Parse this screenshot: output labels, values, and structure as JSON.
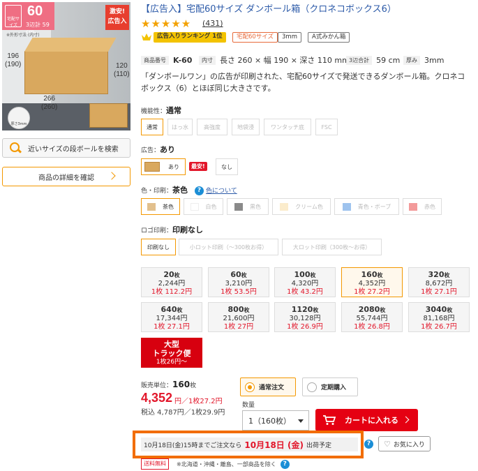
{
  "product": {
    "title": "【広告入】宅配60サイズ ダンボール箱（クロネコボックス6）",
    "stars": "★★★★★",
    "review_count": "(431)",
    "tags": {
      "ranking": "広告入りランキング 1位",
      "size": "宅配60サイズ",
      "thickness": "3mm",
      "type": "A式みかん箱"
    },
    "spec": {
      "code_label": "商品番号",
      "code": "K-60",
      "inner_label": "内寸",
      "inner": "長さ 260 × 幅 190 × 深さ 110 mm",
      "sum_label": "3辺合計",
      "sum": "59 cm",
      "thick_label": "厚み",
      "thick": "3mm"
    },
    "description": "「ダンボールワン」の広告が印刷された、宅配60サイズで発送できるダンボール箱。クロネコボックス（6）とほぼ同じ大きさです。"
  },
  "image": {
    "badge_number": "60",
    "badge_text": "3辺計 59 cm",
    "badge_icon": "宅配サイズ",
    "note": "※外形寸法 (内寸)",
    "sale_flag": "激安!",
    "sale_sub": "広告入",
    "dim_height": "196\n(190)",
    "dim_side": "120\n(110)",
    "dim_length": "266\n(260)",
    "thickness": "厚さ3mm"
  },
  "left": {
    "similar_label": "近いサイズの段ボールを検索",
    "details_label": "商品の詳細を確認"
  },
  "options": {
    "function": {
      "label": "機能性：",
      "value": "通常",
      "items": [
        "通常",
        "はっ水",
        "高強度",
        "地袋浸",
        "ワンタッチ底",
        "FSC"
      ]
    },
    "ad": {
      "label": "広告：",
      "value": "あり",
      "items": [
        "あり",
        "なし"
      ],
      "sale_badge": "最安!"
    },
    "color": {
      "label": "色・印刷：",
      "value": "茶色",
      "link": "色について",
      "items": [
        "茶色",
        "白色",
        "黒色",
        "クリーム色",
        "青色・ボーブ",
        "赤色"
      ],
      "swatches": [
        "#e2c08d",
        "#ffffff",
        "#8a8a8a",
        "#fbeccc",
        "#9ec3ee",
        "#f39a9a"
      ]
    },
    "logo": {
      "label": "ロゴ印刷：",
      "value": "印刷なし",
      "items": [
        "印刷なし",
        "小ロット印刷（～300枚お得）",
        "大ロット印刷（300枚～お得）"
      ]
    }
  },
  "quantities": [
    {
      "n": "20",
      "unit": "枚",
      "price": "2,244円",
      "per": "1枚 112.2円"
    },
    {
      "n": "60",
      "unit": "枚",
      "price": "3,210円",
      "per": "1枚 53.5円"
    },
    {
      "n": "100",
      "unit": "枚",
      "price": "4,320円",
      "per": "1枚 43.2円"
    },
    {
      "n": "160",
      "unit": "枚",
      "price": "4,352円",
      "per": "1枚 27.2円"
    },
    {
      "n": "320",
      "unit": "枚",
      "price": "8,672円",
      "per": "1枚 27.1円"
    },
    {
      "n": "640",
      "unit": "枚",
      "price": "17,344円",
      "per": "1枚 27.1円"
    },
    {
      "n": "800",
      "unit": "枚",
      "price": "21,600円",
      "per": "1枚 27円"
    },
    {
      "n": "1120",
      "unit": "枚",
      "price": "30,128円",
      "per": "1枚 26.9円"
    },
    {
      "n": "2080",
      "unit": "枚",
      "price": "55,744円",
      "per": "1枚 26.8円"
    },
    {
      "n": "3040",
      "unit": "枚",
      "price": "81,168円",
      "per": "1枚 26.7円"
    }
  ],
  "truck": {
    "line1": "大型",
    "line2": "トラック便",
    "line3": "1枚26円～"
  },
  "purchase": {
    "sales_unit_label": "販売単位：",
    "sales_unit": "160",
    "sales_unit_suffix": "枚",
    "price": "4,352",
    "price_suffix": "円／1枚27.2円",
    "tax": "税込 4,787円／1枚29.9円",
    "normal_order": "通常注文",
    "subscription": "定期購入",
    "qty_label": "数量",
    "qty_value": "1（160枚）",
    "cart": "カートに入れる",
    "ship_pre": "10月18日(金)15時までご注文なら",
    "ship_date": "10月18日 (金)",
    "ship_post": "出荷予定",
    "favorite": "お気に入り",
    "free_ship": "送料無料",
    "free_note": "※北海道・沖縄・離島、一部商品を除く"
  }
}
